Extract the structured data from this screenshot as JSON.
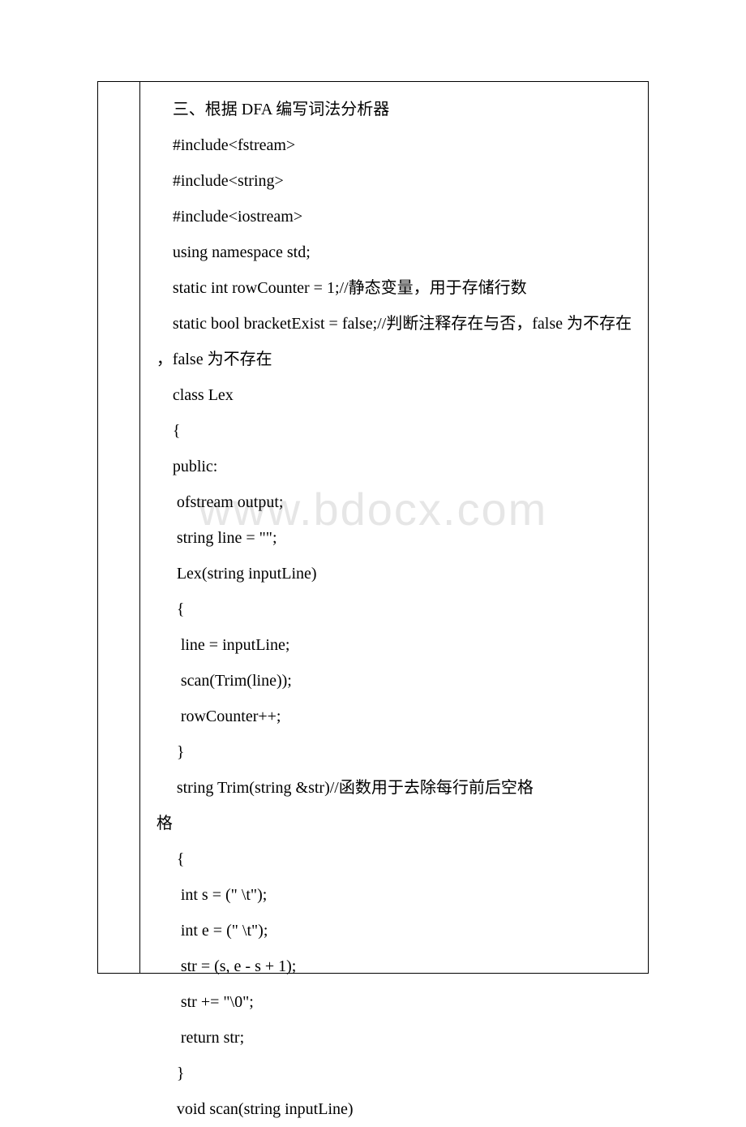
{
  "watermark": "www.bdocx.com",
  "lines": [
    "    三、根据 DFA 编写词法分析器",
    "    #include<fstream>",
    "    #include<string>",
    "    #include<iostream>",
    "    using namespace std;",
    "    static int rowCounter = 1;//静态变量，用于存储行数",
    "    static bool bracketExist = false;//判断注释存在与否，false 为不存在",
    "    class Lex",
    "    {",
    "    public:",
    "     ofstream output;",
    "     string line = \"\";",
    "     Lex(string inputLine)",
    "     {",
    "      line = inputLine;",
    "      scan(Trim(line));",
    "      rowCounter++;",
    "     }",
    "     string Trim(string &str)//函数用于去除每行前后空格",
    "     {",
    "      int s = (\" \\t\");",
    "      int e = (\" \\t\");",
    "      str = (s, e - s + 1);",
    "      str += \"\\0\";",
    "      return str;",
    "     }",
    "     void scan(string inputLine)"
  ],
  "wrapped_line_indices": {
    "6": "，false 为不存在",
    "18": "格"
  }
}
